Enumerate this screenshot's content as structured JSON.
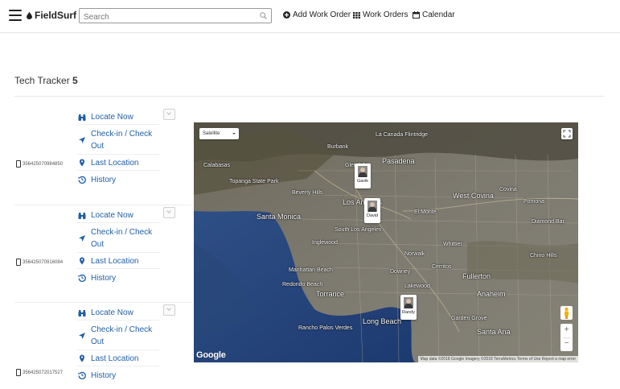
{
  "header": {
    "brand": "FieldSurf",
    "search_placeholder": "Search",
    "nav": [
      {
        "label": "Add Work Order"
      },
      {
        "label": "Work Orders"
      },
      {
        "label": "Calendar"
      }
    ]
  },
  "page": {
    "title": "Tech Tracker",
    "count": "5"
  },
  "devices": [
    {
      "id": "356425070984850"
    },
    {
      "id": "356425070916084"
    },
    {
      "id": "356425072017527"
    }
  ],
  "actions": {
    "locate": "Locate Now",
    "checkin": "Check-in / Check",
    "checkin2": "Out",
    "last": "Last Location",
    "history": "History"
  },
  "map": {
    "type_label": "Satellite",
    "google": "Google",
    "attribution": "Map data ©2018 Google Imagery ©2018 TerraMetrics   Terms of Use   Report a map error",
    "places": [
      "La Canada Flintridge",
      "Burbank",
      "Pasadena",
      "Calabasas",
      "Glendale",
      "Topanga State Park",
      "Beverly Hills",
      "Los Angeles",
      "West Covina",
      "Covina",
      "Pomona",
      "Santa Monica",
      "Inglewood",
      "South Los Angeles",
      "Downey",
      "El Monte",
      "Manhattan Beach",
      "Redondo Beach",
      "Torrance",
      "Lakewood",
      "Fullerton",
      "Anaheim",
      "Chino Hills",
      "Garden Grove",
      "Santa Ana",
      "Long Beach",
      "Rancho Palos Verdes",
      "Diamond Bar",
      "Whittier",
      "Norwalk",
      "Cerritos"
    ],
    "markers": [
      {
        "name": "Gavik"
      },
      {
        "name": "David"
      },
      {
        "name": "Randy"
      }
    ],
    "zoom_in": "+",
    "zoom_out": "−"
  }
}
